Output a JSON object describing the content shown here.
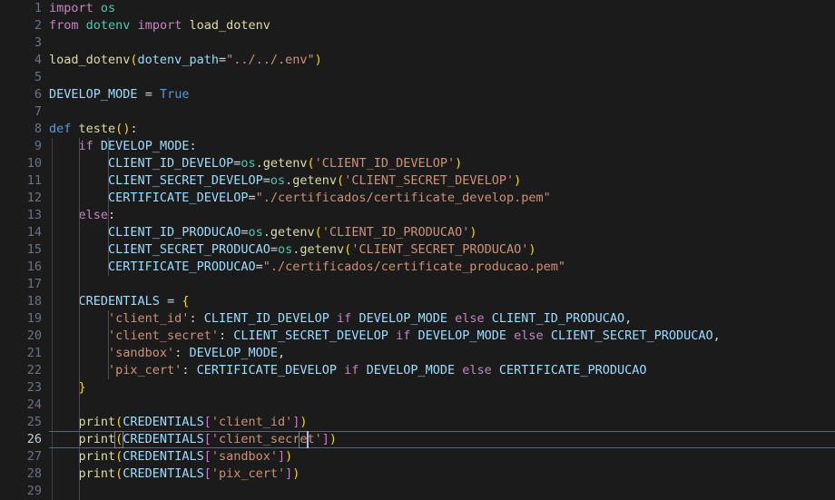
{
  "editor": {
    "language": "python",
    "background_color": "#1b1b1b",
    "gutter_color": "#6a7287",
    "active_line_number_color": "#c9ccd4",
    "current_line_number": 26,
    "caret_color": "#b9b6e8",
    "total_lines": 29,
    "first_visible_line": 1,
    "indent_guide_color": "#4a4d55",
    "current_line_border_color": "#5b6478",
    "bracket_match_border_color": "#7a8192"
  },
  "line_numbers": [
    "1",
    "2",
    "3",
    "4",
    "5",
    "6",
    "7",
    "8",
    "9",
    "10",
    "11",
    "12",
    "13",
    "14",
    "15",
    "16",
    "17",
    "18",
    "19",
    "20",
    "21",
    "22",
    "23",
    "24",
    "25",
    "26",
    "27",
    "28",
    "29"
  ],
  "code_lines": [
    {
      "n": 1,
      "text": "import os"
    },
    {
      "n": 2,
      "text": "from dotenv import load_dotenv"
    },
    {
      "n": 3,
      "text": ""
    },
    {
      "n": 4,
      "text": "load_dotenv(dotenv_path=\"../../.env\")"
    },
    {
      "n": 5,
      "text": ""
    },
    {
      "n": 6,
      "text": "DEVELOP_MODE = True"
    },
    {
      "n": 7,
      "text": ""
    },
    {
      "n": 8,
      "text": "def teste():"
    },
    {
      "n": 9,
      "text": "    if DEVELOP_MODE:"
    },
    {
      "n": 10,
      "text": "        CLIENT_ID_DEVELOP=os.getenv('CLIENT_ID_DEVELOP')"
    },
    {
      "n": 11,
      "text": "        CLIENT_SECRET_DEVELOP=os.getenv('CLIENT_SECRET_DEVELOP')"
    },
    {
      "n": 12,
      "text": "        CERTIFICATE_DEVELOP=\"./certificados/certificate_develop.pem\""
    },
    {
      "n": 13,
      "text": "    else:"
    },
    {
      "n": 14,
      "text": "        CLIENT_ID_PRODUCAO=os.getenv('CLIENT_ID_PRODUCAO')"
    },
    {
      "n": 15,
      "text": "        CLIENT_SECRET_PRODUCAO=os.getenv('CLIENT_SECRET_PRODUCAO')"
    },
    {
      "n": 16,
      "text": "        CERTIFICATE_PRODUCAO=\"./certificados/certificate_producao.pem\""
    },
    {
      "n": 17,
      "text": ""
    },
    {
      "n": 18,
      "text": "    CREDENTIALS = {"
    },
    {
      "n": 19,
      "text": "        'client_id': CLIENT_ID_DEVELOP if DEVELOP_MODE else CLIENT_ID_PRODUCAO,"
    },
    {
      "n": 20,
      "text": "        'client_secret': CLIENT_SECRET_DEVELOP if DEVELOP_MODE else CLIENT_SECRET_PRODUCAO,"
    },
    {
      "n": 21,
      "text": "        'sandbox': DEVELOP_MODE,"
    },
    {
      "n": 22,
      "text": "        'pix_cert': CERTIFICATE_DEVELOP if DEVELOP_MODE else CERTIFICATE_PRODUCAO"
    },
    {
      "n": 23,
      "text": "    }"
    },
    {
      "n": 24,
      "text": ""
    },
    {
      "n": 25,
      "text": "    print(CREDENTIALS['client_id'])"
    },
    {
      "n": 26,
      "text": "    print(CREDENTIALS['client_secret'])"
    },
    {
      "n": 27,
      "text": "    print(CREDENTIALS['sandbox'])"
    },
    {
      "n": 28,
      "text": "    print(CREDENTIALS['pix_cert'])"
    },
    {
      "n": 29,
      "text": ""
    }
  ],
  "tokens": {
    "line1": [
      [
        "import",
        "kw"
      ],
      [
        " ",
        "op"
      ],
      [
        "os",
        "mod"
      ]
    ],
    "line2": [
      [
        "from",
        "kw"
      ],
      [
        " ",
        "op"
      ],
      [
        "dotenv",
        "mod"
      ],
      [
        " ",
        "op"
      ],
      [
        "import",
        "kw"
      ],
      [
        " ",
        "op"
      ],
      [
        "load_dotenv",
        "fn"
      ]
    ],
    "line4": [
      [
        "load_dotenv",
        "fn"
      ],
      [
        "(",
        "p1"
      ],
      [
        "dotenv_path",
        "var"
      ],
      [
        "=",
        "op"
      ],
      [
        "\"../../.env\"",
        "str"
      ],
      [
        ")",
        "p1"
      ]
    ],
    "line6": [
      [
        "DEVELOP_MODE",
        "var"
      ],
      [
        " ",
        "op"
      ],
      [
        "=",
        "op"
      ],
      [
        " ",
        "op"
      ],
      [
        "True",
        "kw2"
      ]
    ],
    "line8": [
      [
        "def",
        "kw2"
      ],
      [
        " ",
        "op"
      ],
      [
        "teste",
        "fn"
      ],
      [
        "(",
        "p1"
      ],
      [
        ")",
        "p1"
      ],
      [
        ":",
        "punc"
      ]
    ],
    "line9": [
      [
        "    ",
        "op"
      ],
      [
        "if",
        "kw"
      ],
      [
        " ",
        "op"
      ],
      [
        "DEVELOP_MODE",
        "var"
      ],
      [
        ":",
        "punc"
      ]
    ],
    "line10": [
      [
        "        ",
        "op"
      ],
      [
        "CLIENT_ID_DEVELOP",
        "var"
      ],
      [
        "=",
        "op"
      ],
      [
        "os",
        "mod"
      ],
      [
        ".",
        "op"
      ],
      [
        "getenv",
        "fn"
      ],
      [
        "(",
        "p1"
      ],
      [
        "'CLIENT_ID_DEVELOP'",
        "str"
      ],
      [
        ")",
        "p1"
      ]
    ],
    "line11": [
      [
        "        ",
        "op"
      ],
      [
        "CLIENT_SECRET_DEVELOP",
        "var"
      ],
      [
        "=",
        "op"
      ],
      [
        "os",
        "mod"
      ],
      [
        ".",
        "op"
      ],
      [
        "getenv",
        "fn"
      ],
      [
        "(",
        "p1"
      ],
      [
        "'CLIENT_SECRET_DEVELOP'",
        "str"
      ],
      [
        ")",
        "p1"
      ]
    ],
    "line12": [
      [
        "        ",
        "op"
      ],
      [
        "CERTIFICATE_DEVELOP",
        "var"
      ],
      [
        "=",
        "op"
      ],
      [
        "\"./certificados/certificate_develop.pem\"",
        "str"
      ]
    ],
    "line13": [
      [
        "    ",
        "op"
      ],
      [
        "else",
        "kw"
      ],
      [
        ":",
        "punc"
      ]
    ],
    "line14": [
      [
        "        ",
        "op"
      ],
      [
        "CLIENT_ID_PRODUCAO",
        "var"
      ],
      [
        "=",
        "op"
      ],
      [
        "os",
        "mod"
      ],
      [
        ".",
        "op"
      ],
      [
        "getenv",
        "fn"
      ],
      [
        "(",
        "p1"
      ],
      [
        "'CLIENT_ID_PRODUCAO'",
        "str"
      ],
      [
        ")",
        "p1"
      ]
    ],
    "line15": [
      [
        "        ",
        "op"
      ],
      [
        "CLIENT_SECRET_PRODUCAO",
        "var"
      ],
      [
        "=",
        "op"
      ],
      [
        "os",
        "mod"
      ],
      [
        ".",
        "op"
      ],
      [
        "getenv",
        "fn"
      ],
      [
        "(",
        "p1"
      ],
      [
        "'CLIENT_SECRET_PRODUCAO'",
        "str"
      ],
      [
        ")",
        "p1"
      ]
    ],
    "line16": [
      [
        "        ",
        "op"
      ],
      [
        "CERTIFICATE_PRODUCAO",
        "var"
      ],
      [
        "=",
        "op"
      ],
      [
        "\"./certificados/certificate_producao.pem\"",
        "str"
      ]
    ],
    "line18": [
      [
        "    ",
        "op"
      ],
      [
        "CREDENTIALS",
        "var"
      ],
      [
        " ",
        "op"
      ],
      [
        "=",
        "op"
      ],
      [
        " ",
        "op"
      ],
      [
        "{",
        "p1"
      ]
    ],
    "line19": [
      [
        "        ",
        "op"
      ],
      [
        "'client_id'",
        "str"
      ],
      [
        ":",
        "punc"
      ],
      [
        " ",
        "op"
      ],
      [
        "CLIENT_ID_DEVELOP",
        "var"
      ],
      [
        " ",
        "op"
      ],
      [
        "if",
        "kw"
      ],
      [
        " ",
        "op"
      ],
      [
        "DEVELOP_MODE",
        "var"
      ],
      [
        " ",
        "op"
      ],
      [
        "else",
        "kw"
      ],
      [
        " ",
        "op"
      ],
      [
        "CLIENT_ID_PRODUCAO",
        "var"
      ],
      [
        ",",
        "punc"
      ]
    ],
    "line20": [
      [
        "        ",
        "op"
      ],
      [
        "'client_secret'",
        "str"
      ],
      [
        ":",
        "punc"
      ],
      [
        " ",
        "op"
      ],
      [
        "CLIENT_SECRET_DEVELOP",
        "var"
      ],
      [
        " ",
        "op"
      ],
      [
        "if",
        "kw"
      ],
      [
        " ",
        "op"
      ],
      [
        "DEVELOP_MODE",
        "var"
      ],
      [
        " ",
        "op"
      ],
      [
        "else",
        "kw"
      ],
      [
        " ",
        "op"
      ],
      [
        "CLIENT_SECRET_PRODUCAO",
        "var"
      ],
      [
        ",",
        "punc"
      ]
    ],
    "line21": [
      [
        "        ",
        "op"
      ],
      [
        "'sandbox'",
        "str"
      ],
      [
        ":",
        "punc"
      ],
      [
        " ",
        "op"
      ],
      [
        "DEVELOP_MODE",
        "var"
      ],
      [
        ",",
        "punc"
      ]
    ],
    "line22": [
      [
        "        ",
        "op"
      ],
      [
        "'pix_cert'",
        "str"
      ],
      [
        ":",
        "punc"
      ],
      [
        " ",
        "op"
      ],
      [
        "CERTIFICATE_DEVELOP",
        "var"
      ],
      [
        " ",
        "op"
      ],
      [
        "if",
        "kw"
      ],
      [
        " ",
        "op"
      ],
      [
        "DEVELOP_MODE",
        "var"
      ],
      [
        " ",
        "op"
      ],
      [
        "else",
        "kw"
      ],
      [
        " ",
        "op"
      ],
      [
        "CERTIFICATE_PRODUCAO",
        "var"
      ]
    ],
    "line23": [
      [
        "    ",
        "op"
      ],
      [
        "}",
        "p1"
      ]
    ],
    "line25": [
      [
        "    ",
        "op"
      ],
      [
        "print",
        "fn"
      ],
      [
        "(",
        "p1"
      ],
      [
        "CREDENTIALS",
        "var"
      ],
      [
        "[",
        "p2"
      ],
      [
        "'client_id'",
        "str"
      ],
      [
        "]",
        "p2"
      ],
      [
        ")",
        "p1"
      ]
    ],
    "line26": [
      [
        "    ",
        "op"
      ],
      [
        "print",
        "fn"
      ],
      [
        "(",
        "p1"
      ],
      [
        "CREDENTIALS",
        "var"
      ],
      [
        "[",
        "p2"
      ],
      [
        "'client_secret'",
        "str"
      ],
      [
        "]",
        "p2"
      ],
      [
        ")",
        "p1"
      ]
    ],
    "line27": [
      [
        "    ",
        "op"
      ],
      [
        "print",
        "fn"
      ],
      [
        "(",
        "p1"
      ],
      [
        "CREDENTIALS",
        "var"
      ],
      [
        "[",
        "p2"
      ],
      [
        "'sandbox'",
        "str"
      ],
      [
        "]",
        "p2"
      ],
      [
        ")",
        "p1"
      ]
    ],
    "line28": [
      [
        "    ",
        "op"
      ],
      [
        "print",
        "fn"
      ],
      [
        "(",
        "p1"
      ],
      [
        "CREDENTIALS",
        "var"
      ],
      [
        "[",
        "p2"
      ],
      [
        "'pix_cert'",
        "str"
      ],
      [
        "]",
        "p2"
      ],
      [
        ")",
        "p1"
      ]
    ]
  },
  "indent_guides": [
    {
      "col": 0,
      "from_line": 9,
      "to_line": 29
    },
    {
      "col": 1,
      "from_line": 9,
      "to_line": 16
    },
    {
      "col": 1,
      "from_line": 19,
      "to_line": 22
    }
  ],
  "bracket_matches": [
    {
      "line": 26,
      "col": 9,
      "len": 1
    },
    {
      "line": 26,
      "col": 34,
      "len": 1
    }
  ],
  "caret": {
    "line": 26,
    "col": 35
  }
}
